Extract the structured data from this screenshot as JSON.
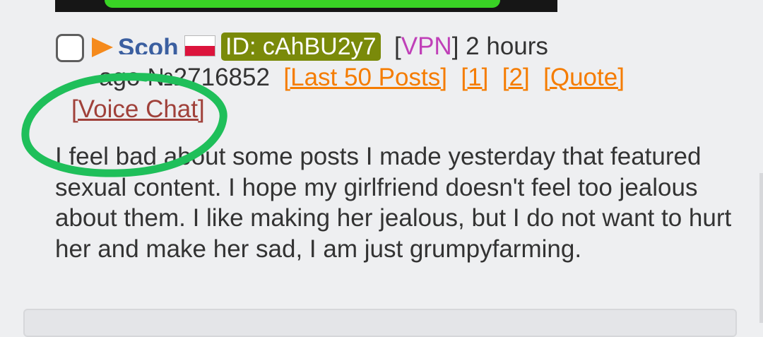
{
  "post": {
    "author_name": "Scoh",
    "id_label": "ID: cAhBU2y7",
    "vpn_open": "[",
    "vpn_label": "VPN",
    "vpn_close": "]",
    "time_part1": " 2 hours",
    "time_part2": "ago",
    "post_number": "№2716852",
    "links": {
      "last50": "[Last 50 Posts]",
      "page1": "[1]",
      "page2": "[2]",
      "quote": "[Quote]",
      "voice_chat": "[Voice Chat]"
    },
    "message": "I feel bad about some posts I made yesterday that featured sexual content. I hope my girlfriend doesn't feel too jealous about them. I like making her jealous, but I do not want to hurt her and make her sad, I am just grumpyfarming."
  },
  "colors": {
    "id_badge_bg": "#7a8a0a",
    "vpn": "#c040b8",
    "link_orange": "#f57c00",
    "link_brown": "#a0413a",
    "annotation_circle": "#1fbf5a",
    "name": "#3b5fa0"
  },
  "icons": {
    "expand": "triangle-right-icon",
    "flag": "poland-flag-icon",
    "select": "checkbox"
  }
}
